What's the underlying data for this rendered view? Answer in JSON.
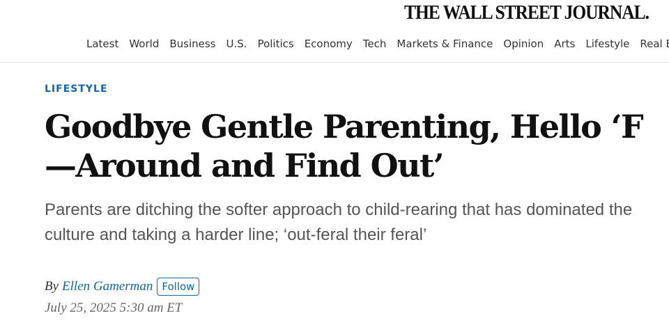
{
  "masthead": {
    "title": "THE WALL STREET JOURNAL."
  },
  "nav": {
    "items": [
      "Latest",
      "World",
      "Business",
      "U.S.",
      "Politics",
      "Economy",
      "Tech",
      "Markets & Finance",
      "Opinion",
      "Arts",
      "Lifestyle",
      "Real Estate"
    ]
  },
  "article": {
    "section": "LIFESTYLE",
    "headline": "Goodbye Gentle Parenting, Hello ‘F—Around and Find Out’",
    "dek": "Parents are ditching the softer approach to child-rearing that has dominated the culture and taking a harder line; ‘out-feral their feral’",
    "byline_prefix": "By",
    "author": "Ellen Gamerman",
    "follow_label": "Follow",
    "timestamp": "July 25, 2025 5:30 am ET"
  },
  "colors": {
    "accent": "#0e6aa6",
    "text": "#111111",
    "dek": "#555555"
  }
}
